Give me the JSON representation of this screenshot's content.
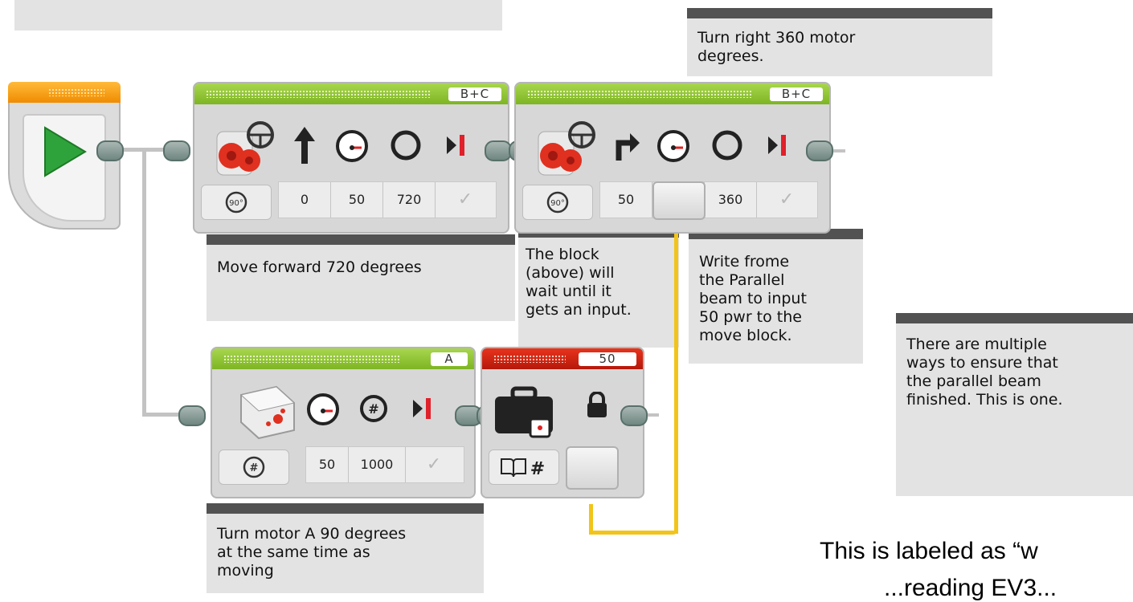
{
  "comments": {
    "top_left": "",
    "turn_right": "Turn right 360 motor\ndegrees.",
    "move_forward": "Move forward 720 degrees",
    "block_wait": "The block\n(above) will\nwait until it\ngets an input.",
    "write_parallel": "Write frome\nthe Parallel\nbeam to input\n50 pwr to the\nmove block.",
    "multiple_ways": "There are multiple\nways to ensure that\nthe parallel beam\nfinished. This is one.",
    "turn_motor_a": "Turn motor A 90 degrees\nat the same time as\nmoving"
  },
  "blocks": {
    "move1": {
      "port": "B+C",
      "steering": "0",
      "power": "50",
      "degrees": "720",
      "mode": "90°"
    },
    "move2": {
      "port": "B+C",
      "steering": "50",
      "power": "",
      "degrees": "360",
      "mode": "90°"
    },
    "motor_a": {
      "port": "A",
      "power": "50",
      "degrees": "1000"
    },
    "variable": {
      "label": "50"
    }
  },
  "bottom_text": {
    "line1": "This is labeled as “w",
    "line2": "...reading EV3..."
  },
  "colors": {
    "green_header": "#7db523",
    "red_header": "#c41c0e",
    "orange_header": "#f08b00",
    "data_wire": "#f2c419",
    "start_play": "#2fa33b"
  },
  "icons": [
    "play-icon",
    "steering-wheel-icon",
    "arrow-up-icon",
    "turn-right-arrow-icon",
    "speedometer-icon",
    "circle-icon",
    "brake-icon",
    "lock-icon",
    "briefcase-icon",
    "book-hash-icon",
    "mode-90-icon",
    "mode-hash-icon",
    "checkmark-icon"
  ]
}
